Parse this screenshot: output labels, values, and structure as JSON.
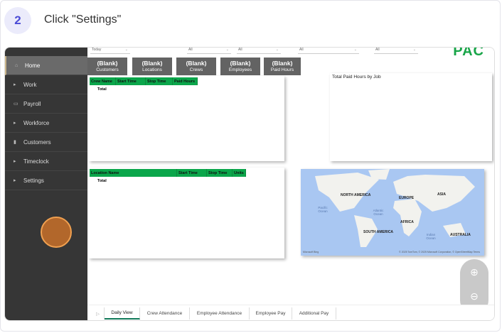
{
  "step": {
    "number": "2",
    "instruction": "Click \"Settings\""
  },
  "sidebar": {
    "items": [
      {
        "label": "Home",
        "icon": "home-icon"
      },
      {
        "label": "Work",
        "icon": "caret-right-icon"
      },
      {
        "label": "Payroll",
        "icon": "money-icon"
      },
      {
        "label": "Workforce",
        "icon": "caret-right-icon"
      },
      {
        "label": "Customers",
        "icon": "building-icon"
      },
      {
        "label": "Timeclock",
        "icon": "caret-right-icon"
      },
      {
        "label": "Settings",
        "icon": "caret-right-icon"
      }
    ]
  },
  "filters": [
    "Today",
    "All",
    "All",
    "All",
    "All"
  ],
  "kpis": [
    {
      "value": "(Blank)",
      "label": "Customers"
    },
    {
      "value": "(Blank)",
      "label": "Locations"
    },
    {
      "value": "(Blank)",
      "label": "Crews"
    },
    {
      "value": "(Blank)",
      "label": "Employees"
    },
    {
      "value": "(Blank)",
      "label": "Paid Hours"
    }
  ],
  "crew_table": {
    "headers": [
      "Crew Name",
      "Start Time",
      "Stop Time",
      "Paid Hours"
    ],
    "total": "Total"
  },
  "location_table": {
    "headers": [
      "Location Name",
      "Start Time",
      "Stop Time",
      "Units"
    ],
    "total": "Total"
  },
  "chart": {
    "title": "Total Paid Hours by Job"
  },
  "map": {
    "labels": [
      "NORTH AMERICA",
      "EUROPE",
      "ASIA",
      "AFRICA",
      "SOUTH AMERICA",
      "AUSTRALIA"
    ],
    "oceans": [
      "Pacific Ocean",
      "Atlantic Ocean",
      "Indian Ocean"
    ],
    "brand": "Microsoft Bing",
    "attribution": "© 2025 TomTom, © 2025 Microsoft Corporation, © OpenStreetMap  Terms"
  },
  "tabs": [
    "Daily View",
    "Crew Attendance",
    "Employee Attendance",
    "Employee Pay",
    "Additional Pay"
  ],
  "logo": "PAC"
}
